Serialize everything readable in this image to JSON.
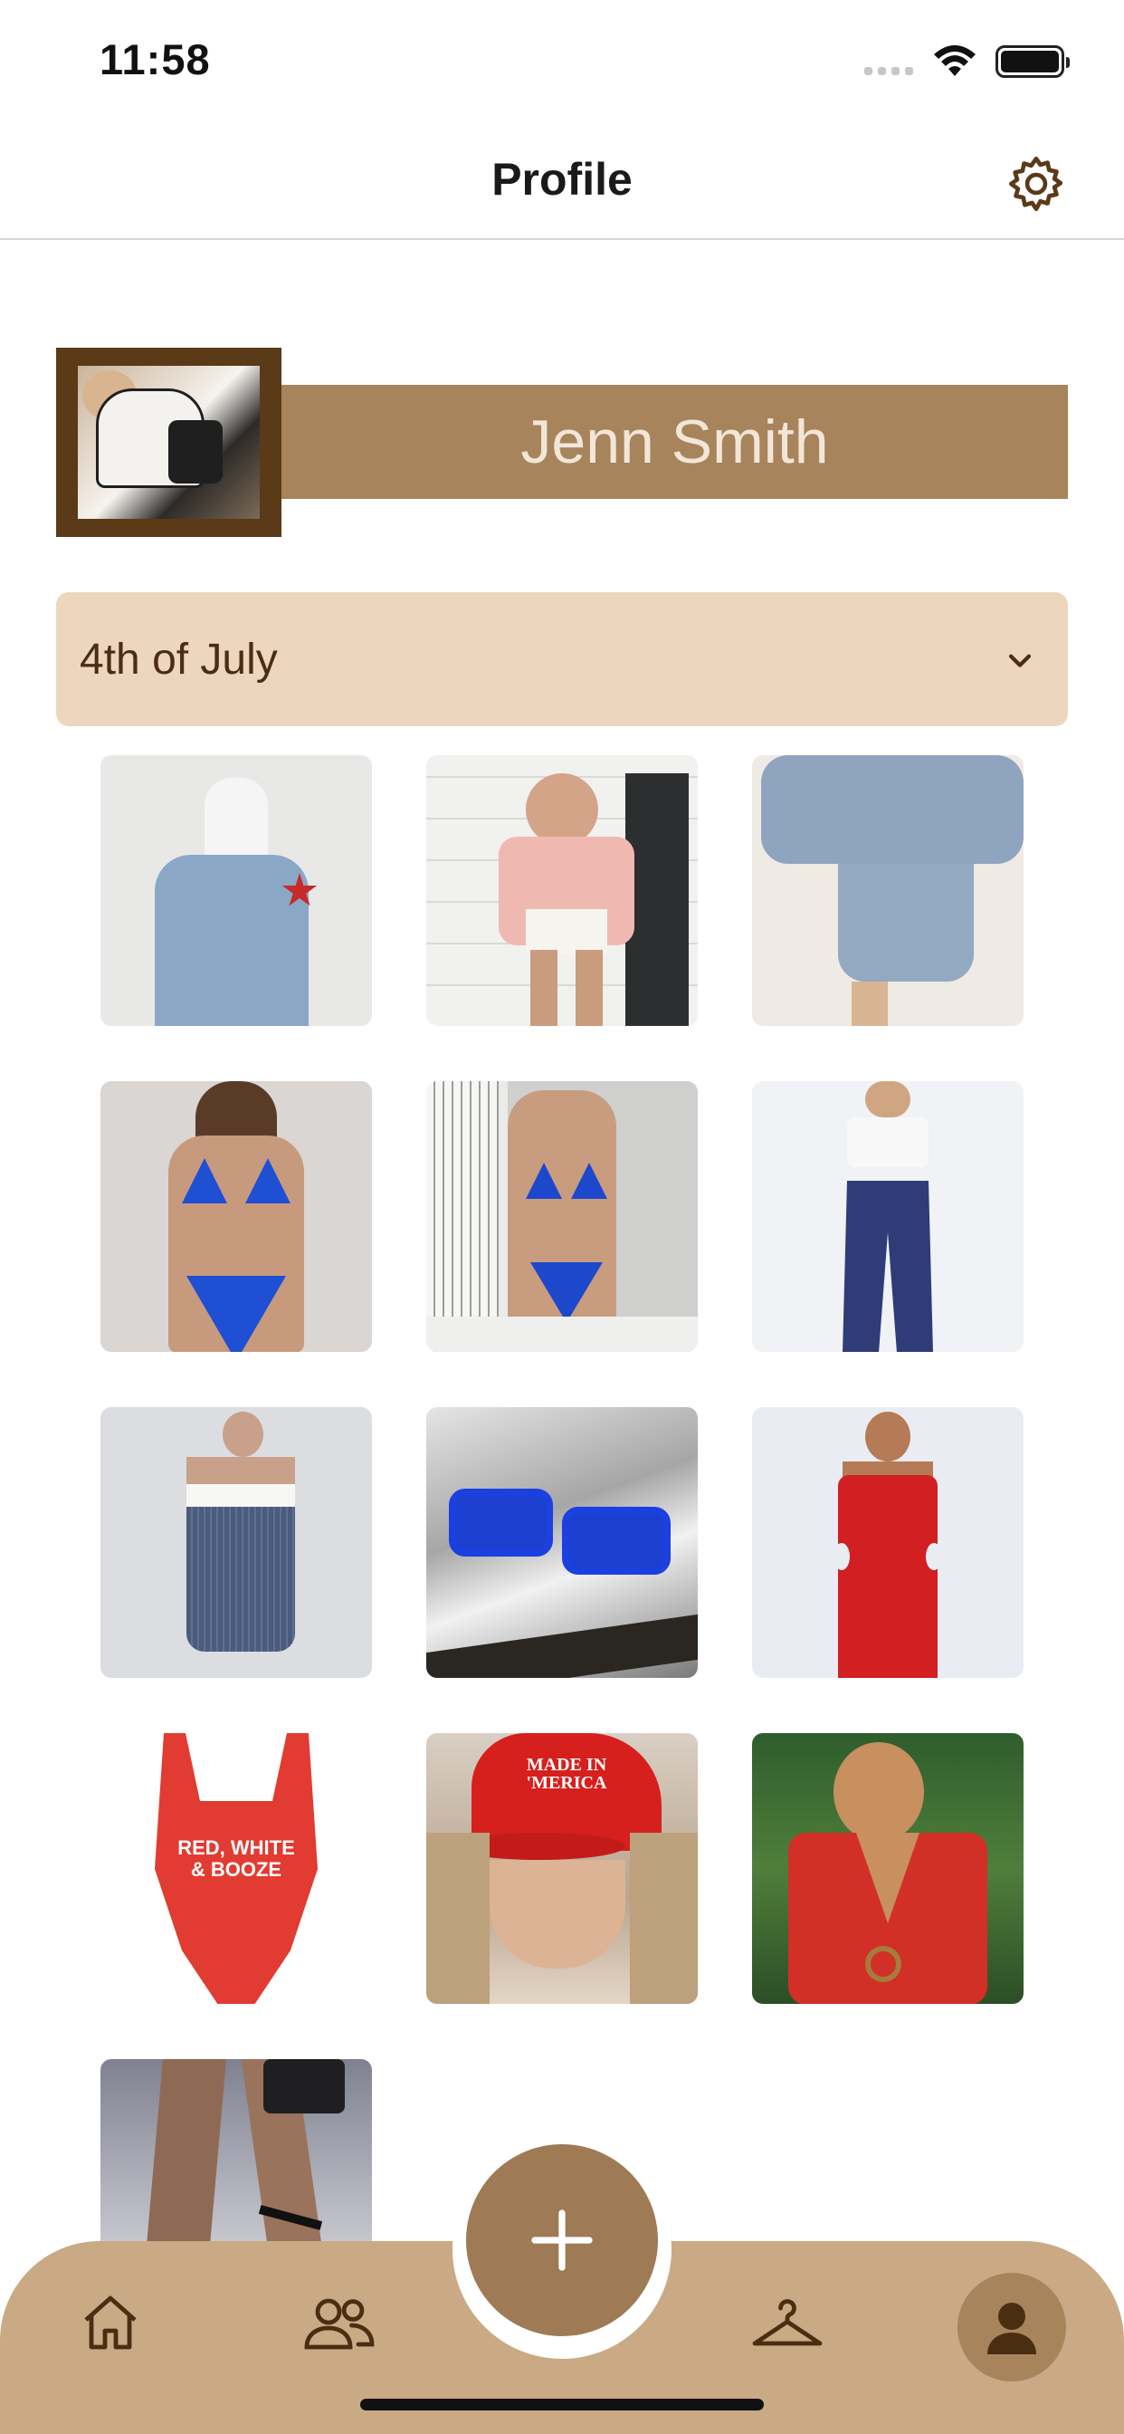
{
  "status_bar": {
    "time": "11:58"
  },
  "header": {
    "title": "Profile",
    "settings_icon": "gear-icon"
  },
  "profile": {
    "name": "Jenn Smith"
  },
  "collection": {
    "selected": "4th of July"
  },
  "outfit_items": [
    {
      "name": "item-star-jeans"
    },
    {
      "name": "item-pink-cardigan-look"
    },
    {
      "name": "item-blue-pleated-set"
    },
    {
      "name": "item-blue-bikini"
    },
    {
      "name": "item-blue-bikini-mirror"
    },
    {
      "name": "item-navy-pants-white-top"
    },
    {
      "name": "item-striped-strapless-dress"
    },
    {
      "name": "item-blue-sunglasses"
    },
    {
      "name": "item-red-cutout-dress"
    },
    {
      "name": "item-red-white-booze-swimsuit"
    },
    {
      "name": "item-made-in-merica-cap"
    },
    {
      "name": "item-red-knit-set"
    },
    {
      "name": "item-black-strappy-heels"
    }
  ],
  "tab_bar": {
    "items": [
      "home-icon",
      "friends-icon",
      "add-button",
      "hanger-icon",
      "profile-icon"
    ],
    "active": "profile"
  },
  "colors": {
    "brand_dark": "#5b3a18",
    "brand": "#a8845c",
    "dropdown_bg": "#ecd6bd",
    "tab_bar_bg": "#c9aa84"
  }
}
